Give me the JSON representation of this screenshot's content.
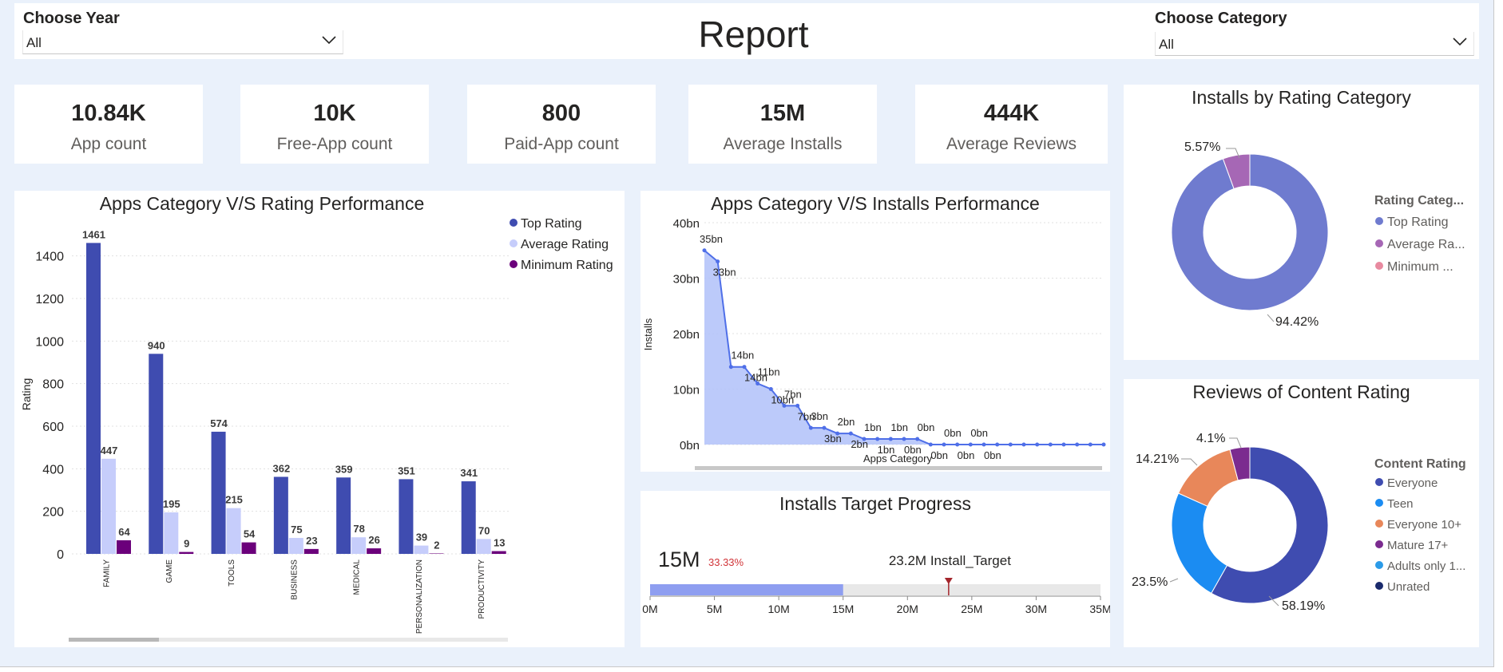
{
  "report": {
    "title": "Report"
  },
  "year_slicer": {
    "label": "Choose Year",
    "value": "All"
  },
  "category_slicer": {
    "label": "Choose Category",
    "value": "All"
  },
  "kpis": [
    {
      "value": "10.84K",
      "label": "App count"
    },
    {
      "value": "10K",
      "label": "Free-App count"
    },
    {
      "value": "800",
      "label": "Paid-App count"
    },
    {
      "value": "15M",
      "label": "Average Installs"
    },
    {
      "value": "444K",
      "label": "Average Reviews"
    }
  ],
  "rating_chart": {
    "title": "Apps Category V/S Rating Performance",
    "ylabel": "Rating",
    "legend": [
      "Top Rating",
      "Average Rating",
      "Minimum Rating"
    ],
    "colors": [
      "#3f4cb0",
      "#c6cdfb",
      "#6b007b"
    ]
  },
  "installs_chart": {
    "title": "Apps Category V/S Installs Performance",
    "ylabel": "Installs",
    "xlabel": "Apps Category",
    "yticks": [
      "0bn",
      "10bn",
      "20bn",
      "30bn",
      "40bn"
    ]
  },
  "target": {
    "title": "Installs Target Progress",
    "value_label": "15M",
    "pct_label": "33.33%",
    "target_label": "23.2M Install_Target",
    "ticks": [
      "0M",
      "5M",
      "10M",
      "15M",
      "20M",
      "25M",
      "30M",
      "35M"
    ]
  },
  "donut_rating": {
    "title": "Installs by Rating Category",
    "legend_title": "Rating Categ...",
    "legend": [
      "Top Rating",
      "Average Ra...",
      "Minimum ..."
    ],
    "legend_colors": [
      "#6f7bcf",
      "#a667b5",
      "#e88aa0"
    ],
    "labels": [
      "5.57%",
      "94.42%"
    ]
  },
  "donut_content": {
    "title": "Reviews of Content Rating",
    "legend_title": "Content Rating",
    "legend": [
      "Everyone",
      "Teen",
      "Everyone 10+",
      "Mature 17+",
      "Adults only 1...",
      "Unrated"
    ],
    "legend_colors": [
      "#3f4cb0",
      "#1b8cf2",
      "#e8875a",
      "#7b2b8f",
      "#2b9be8",
      "#1a2a6c"
    ],
    "labels": [
      "4.1%",
      "14.21%",
      "23.5%",
      "58.19%"
    ]
  },
  "chart_data": [
    {
      "type": "bar",
      "title": "Apps Category V/S Rating Performance",
      "ylabel": "Rating",
      "xlabel": "",
      "ylim": [
        0,
        1500
      ],
      "yticks": [
        0,
        200,
        400,
        600,
        800,
        1000,
        1200,
        1400
      ],
      "categories": [
        "FAMILY",
        "GAME",
        "TOOLS",
        "BUSINESS",
        "MEDICAL",
        "PERSONALIZATION",
        "PRODUCTIVITY"
      ],
      "series": [
        {
          "name": "Top Rating",
          "values": [
            1461,
            940,
            574,
            362,
            359,
            351,
            341
          ]
        },
        {
          "name": "Average Rating",
          "values": [
            447,
            195,
            215,
            75,
            78,
            39,
            70
          ]
        },
        {
          "name": "Minimum Rating",
          "values": [
            64,
            9,
            54,
            23,
            26,
            2,
            13
          ]
        }
      ]
    },
    {
      "type": "area",
      "title": "Apps Category V/S Installs Performance",
      "ylabel": "Installs",
      "xlabel": "Apps Category",
      "ylim": [
        0,
        40
      ],
      "unit": "bn",
      "values": [
        35,
        33,
        14,
        14,
        11,
        10,
        7,
        7,
        3,
        3,
        2,
        2,
        1,
        1,
        1,
        1,
        1,
        0,
        0,
        0,
        0,
        0,
        0,
        0,
        0,
        0,
        0,
        0,
        0,
        0,
        0
      ],
      "point_labels": [
        "35bn",
        "33bn",
        "14bn",
        "14bn",
        "11bn",
        "10bn",
        "7bn",
        "7bn",
        "3bn",
        "3bn",
        "2bn",
        "2bn",
        "1bn",
        "1bn",
        "1bn",
        "0bn",
        "0bn",
        "0bn",
        "0bn",
        "0bn",
        "0bn",
        "0bn"
      ]
    },
    {
      "type": "pie",
      "title": "Installs by Rating Category",
      "categories": [
        "Top Rating",
        "Average Rating"
      ],
      "values": [
        94.42,
        5.57
      ]
    },
    {
      "type": "pie",
      "title": "Reviews of Content Rating",
      "categories": [
        "Everyone",
        "Teen",
        "Everyone 10+",
        "Mature 17+"
      ],
      "values": [
        58.19,
        23.5,
        14.21,
        4.1
      ]
    },
    {
      "type": "bar",
      "title": "Installs Target Progress",
      "value": 15,
      "target": 23.2,
      "max": 35,
      "unit": "M"
    }
  ]
}
